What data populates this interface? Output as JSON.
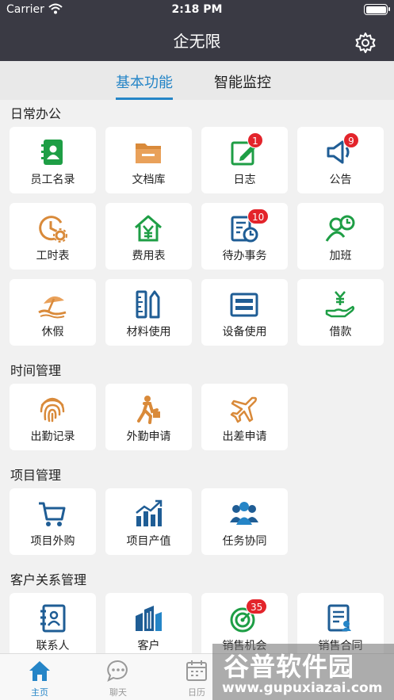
{
  "status_bar": {
    "carrier": "Carrier",
    "time": "2:18 PM"
  },
  "header": {
    "title": "企无限"
  },
  "tabs": [
    {
      "label": "基本功能",
      "active": true
    },
    {
      "label": "智能监控",
      "active": false
    }
  ],
  "sections": [
    {
      "title": "日常办公",
      "items": [
        {
          "label": "员工名录",
          "icon": "contacts-book-icon"
        },
        {
          "label": "文档库",
          "icon": "folder-icon"
        },
        {
          "label": "日志",
          "icon": "edit-note-icon",
          "badge": "1"
        },
        {
          "label": "公告",
          "icon": "megaphone-icon",
          "badge": "9"
        },
        {
          "label": "工时表",
          "icon": "clock-gear-icon"
        },
        {
          "label": "费用表",
          "icon": "yuan-house-icon"
        },
        {
          "label": "待办事务",
          "icon": "todo-list-icon",
          "badge": "10"
        },
        {
          "label": "加班",
          "icon": "person-clock-icon"
        },
        {
          "label": "休假",
          "icon": "beach-umbrella-icon"
        },
        {
          "label": "材料使用",
          "icon": "ruler-pencil-icon"
        },
        {
          "label": "设备使用",
          "icon": "device-icon"
        },
        {
          "label": "借款",
          "icon": "hand-yuan-icon"
        }
      ]
    },
    {
      "title": "时间管理",
      "items": [
        {
          "label": "出勤记录",
          "icon": "fingerprint-icon"
        },
        {
          "label": "外勤申请",
          "icon": "walking-person-icon"
        },
        {
          "label": "出差申请",
          "icon": "airplane-icon"
        }
      ]
    },
    {
      "title": "项目管理",
      "items": [
        {
          "label": "项目外购",
          "icon": "shopping-cart-icon"
        },
        {
          "label": "项目产值",
          "icon": "bar-chart-icon"
        },
        {
          "label": "任务协同",
          "icon": "people-group-icon"
        }
      ]
    },
    {
      "title": "客户关系管理",
      "items": [
        {
          "label": "联系人",
          "icon": "contact-card-icon"
        },
        {
          "label": "客户",
          "icon": "buildings-icon"
        },
        {
          "label": "销售机会",
          "icon": "target-icon",
          "badge": "35"
        },
        {
          "label": "销售合同",
          "icon": "contract-icon"
        }
      ]
    }
  ],
  "bottom_nav": [
    {
      "label": "主页",
      "icon": "home-icon",
      "active": true
    },
    {
      "label": "聊天",
      "icon": "chat-icon",
      "active": false
    },
    {
      "label": "日历",
      "icon": "calendar-icon",
      "active": false
    }
  ],
  "watermark": {
    "text": "谷普软件园",
    "url": "www.gupuxiazai.com"
  },
  "colors": {
    "header": "#3a3a44",
    "accent": "#2585c7",
    "green": "#1e9e45",
    "orange": "#d98a3a",
    "navy": "#1f5d95",
    "badge": "#e3242b"
  }
}
